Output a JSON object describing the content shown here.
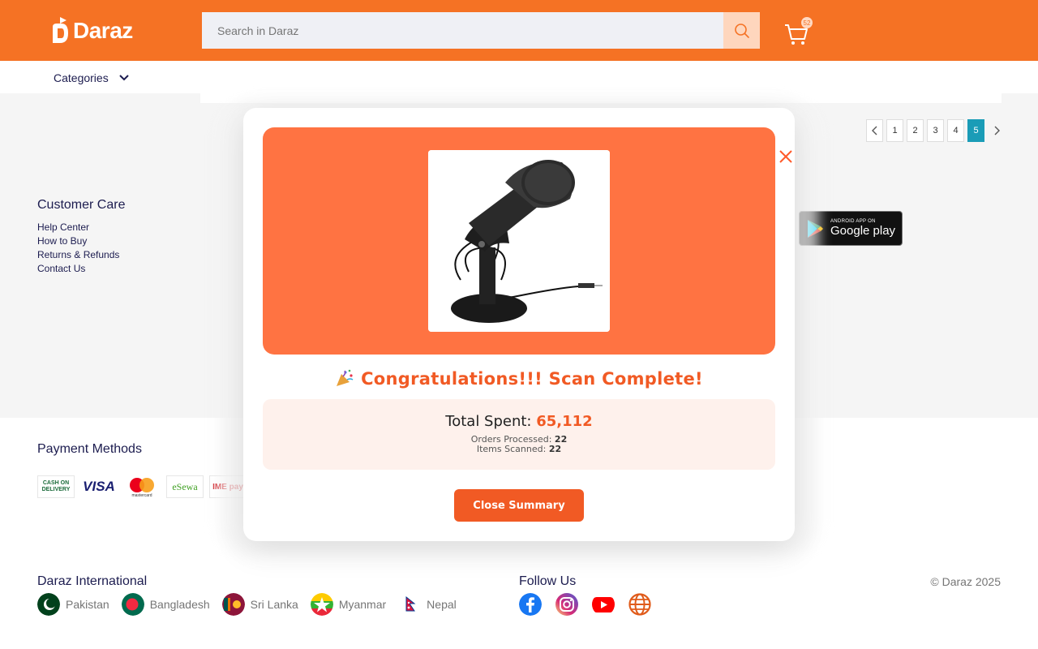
{
  "brand": {
    "name": "Daraz",
    "accent": "#f57224"
  },
  "header": {
    "search_placeholder": "Search in Daraz",
    "cart_count": "52"
  },
  "nav": {
    "categories_label": "Categories"
  },
  "pagination": {
    "pages": [
      "1",
      "2",
      "3",
      "4",
      "5"
    ],
    "active": "5"
  },
  "footer": {
    "customer_care": {
      "title": "Customer Care",
      "links": [
        "Help Center",
        "How to Buy",
        "Returns & Refunds",
        "Contact Us"
      ]
    },
    "app_badge": {
      "small": "ANDROID APP ON",
      "big": "Google play"
    },
    "payment": {
      "title": "Payment Methods",
      "methods": [
        "CASH ON DELIVERY",
        "VISA",
        "mastercard",
        "eSewa",
        "IME pay"
      ]
    },
    "international": {
      "title": "Daraz International",
      "countries": [
        "Pakistan",
        "Bangladesh",
        "Sri Lanka",
        "Myanmar",
        "Nepal"
      ]
    },
    "follow": {
      "title": "Follow Us",
      "icons": [
        "facebook-icon",
        "instagram-icon",
        "youtube-icon",
        "globe-icon"
      ]
    },
    "copyright": "© Daraz 2025"
  },
  "modal": {
    "headline": "Congratulations!!! Scan Complete!",
    "total_label": "Total Spent:",
    "total_value": "65,112",
    "orders_label": "Orders Processed:",
    "orders_value": "22",
    "items_label": "Items Scanned:",
    "items_value": "22",
    "close_button": "Close Summary",
    "product_image": "microphone-image"
  }
}
